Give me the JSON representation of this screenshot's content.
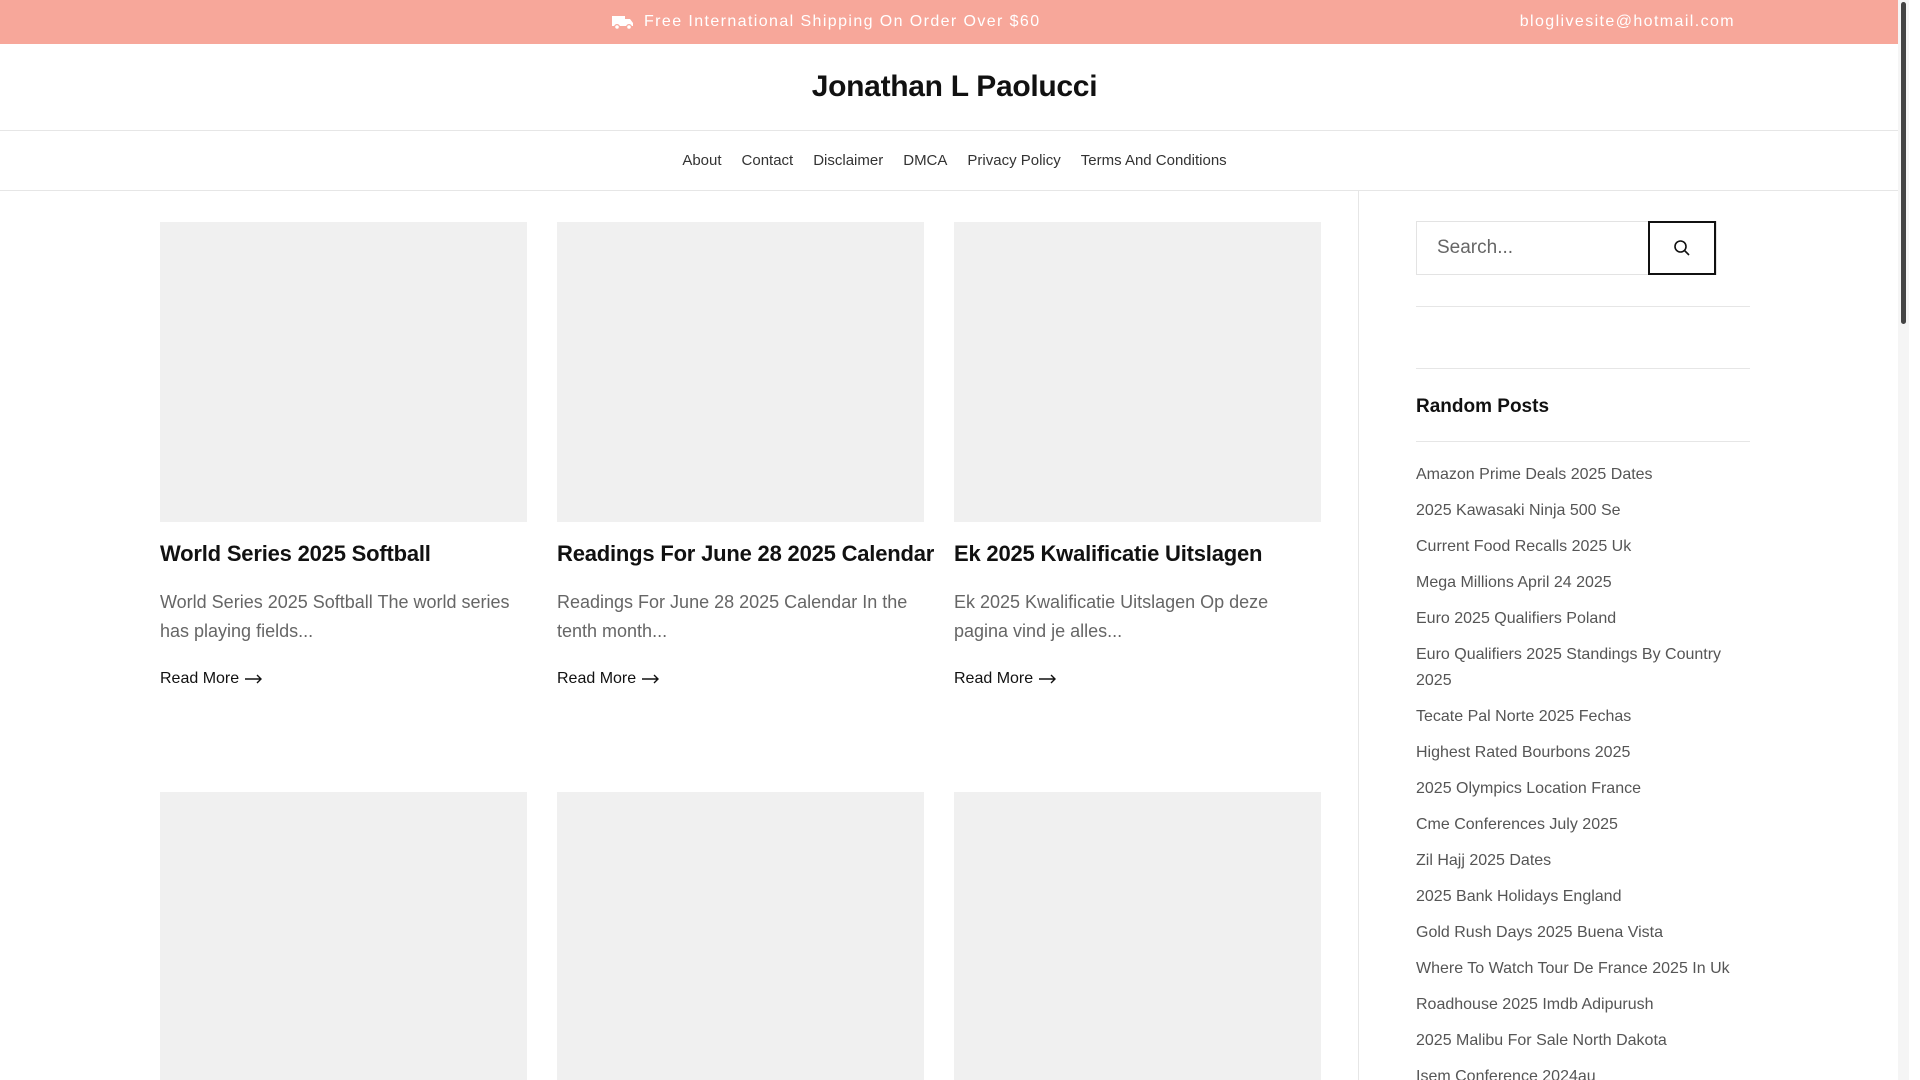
{
  "topbar": {
    "shipping_text": "Free International Shipping On Order Over $60",
    "email": "bloglivesite@hotmail.com",
    "truck_icon": "truck-icon"
  },
  "header": {
    "site_title": "Jonathan L Paolucci"
  },
  "nav": {
    "items": [
      "About",
      "Contact",
      "Disclaimer",
      "DMCA",
      "Privacy Policy",
      "Terms And Conditions"
    ]
  },
  "posts": [
    {
      "title": "World Series 2025 Softball",
      "excerpt": "World Series 2025 Softball The world series has playing fields...",
      "read_more": "Read More"
    },
    {
      "title": "Readings For June 28 2025 Calendar",
      "excerpt": "Readings For June 28 2025 Calendar In the tenth month...",
      "read_more": "Read More"
    },
    {
      "title": "Ek 2025 Kwalificatie Uitslagen",
      "excerpt": "Ek 2025 Kwalificatie Uitslagen Op deze pagina vind je alles...",
      "read_more": "Read More"
    }
  ],
  "sidebar": {
    "search_placeholder": "Search...",
    "random_posts_title": "Random Posts",
    "random_posts": [
      "Amazon Prime Deals 2025 Dates",
      "2025 Kawasaki Ninja 500 Se",
      "Current Food Recalls 2025 Uk",
      "Mega Millions April 24 2025",
      "Euro 2025 Qualifiers Poland",
      "Euro Qualifiers 2025 Standings By Country 2025",
      "Tecate Pal Norte 2025 Fechas",
      "Highest Rated Bourbons 2025",
      "2025 Olympics Location France",
      "Cme Conferences July 2025",
      "Zil Hajj 2025 Dates",
      "2025 Bank Holidays England",
      "Gold Rush Days 2025 Buena Vista",
      "Where To Watch Tour De France 2025 In Uk",
      "Roadhouse 2025 Imdb Adipurush",
      "2025 Malibu For Sale North Dakota",
      "Isem Conference 2024au"
    ]
  },
  "colors": {
    "topbar_bg": "#f7a79a",
    "thumb_placeholder": "#f0f0f0"
  }
}
